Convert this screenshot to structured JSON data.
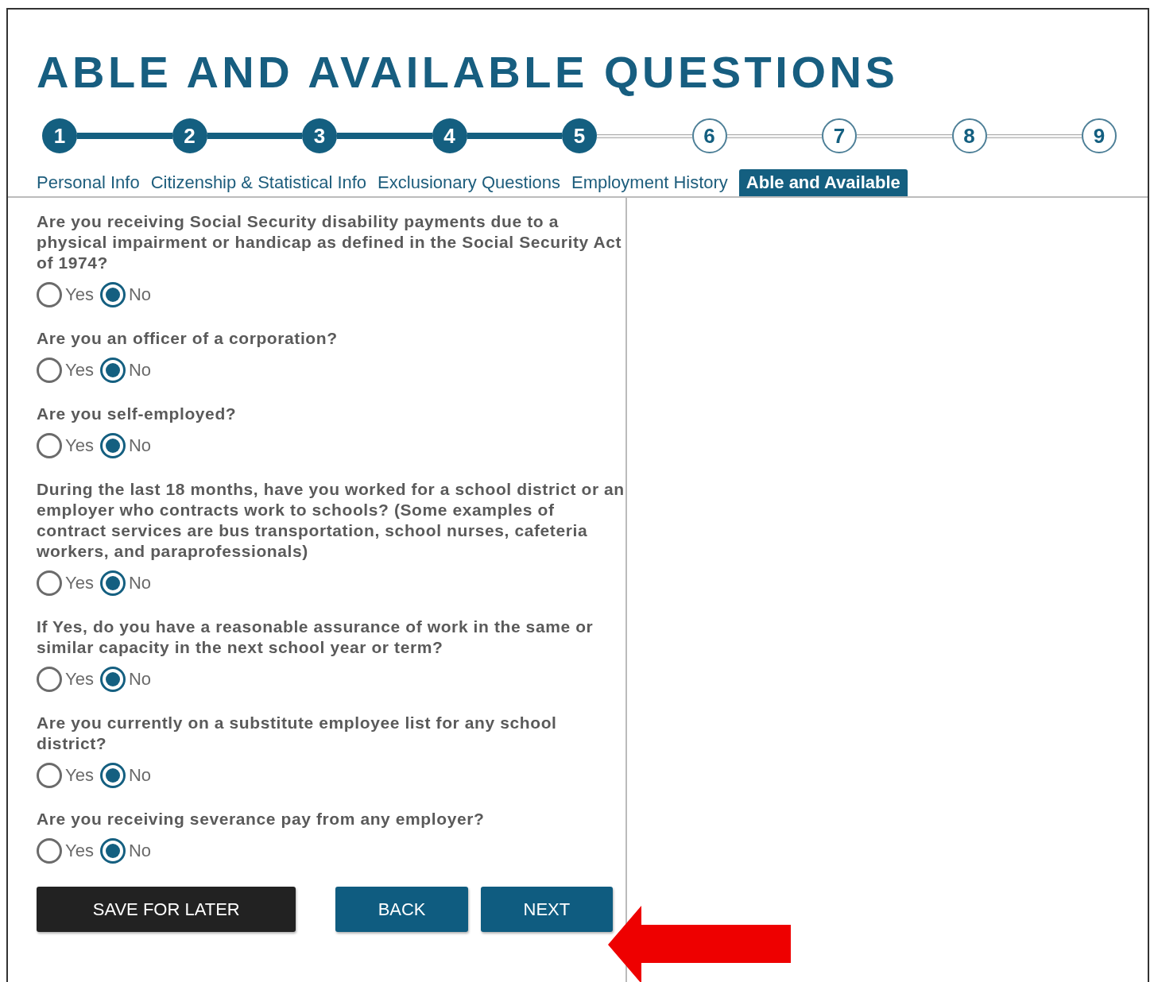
{
  "title": "ABLE AND AVAILABLE QUESTIONS",
  "steps": [
    {
      "number": "1",
      "done": true
    },
    {
      "number": "2",
      "done": true
    },
    {
      "number": "3",
      "done": true
    },
    {
      "number": "4",
      "done": true
    },
    {
      "number": "5",
      "done": true
    },
    {
      "number": "6",
      "done": false
    },
    {
      "number": "7",
      "done": false
    },
    {
      "number": "8",
      "done": false
    },
    {
      "number": "9",
      "done": false
    }
  ],
  "tabs": [
    {
      "label": "Personal Info",
      "selected": false
    },
    {
      "label": "Citizenship & Statistical Info",
      "selected": false
    },
    {
      "label": "Exclusionary Questions",
      "selected": false
    },
    {
      "label": "Employment History",
      "selected": false
    },
    {
      "label": "Able and Available",
      "selected": true
    }
  ],
  "questions": [
    {
      "text": "Are you receiving Social Security disability payments due to a physical impairment or handicap as defined in the Social Security Act of 1974?",
      "options": [
        {
          "label": "Yes",
          "selected": false
        },
        {
          "label": "No",
          "selected": true
        }
      ]
    },
    {
      "text": "Are you an officer of a corporation?",
      "options": [
        {
          "label": "Yes",
          "selected": false
        },
        {
          "label": "No",
          "selected": true
        }
      ]
    },
    {
      "text": "Are you self-employed?",
      "options": [
        {
          "label": "Yes",
          "selected": false
        },
        {
          "label": "No",
          "selected": true
        }
      ]
    },
    {
      "text": "During the last 18 months, have you worked for a school district or an employer who contracts work to schools? (Some examples of contract services are bus transportation, school nurses, cafeteria workers, and paraprofessionals)",
      "options": [
        {
          "label": "Yes",
          "selected": false
        },
        {
          "label": "No",
          "selected": true
        }
      ]
    },
    {
      "text": "If Yes, do you have a reasonable assurance of work in the same or similar capacity in the next school year or term?",
      "options": [
        {
          "label": "Yes",
          "selected": false
        },
        {
          "label": "No",
          "selected": true
        }
      ]
    },
    {
      "text": "Are you currently on a substitute employee list for any school district?",
      "options": [
        {
          "label": "Yes",
          "selected": false
        },
        {
          "label": "No",
          "selected": true
        }
      ]
    },
    {
      "text": "Are you receiving severance pay from any employer?",
      "options": [
        {
          "label": "Yes",
          "selected": false
        },
        {
          "label": "No",
          "selected": true
        }
      ]
    }
  ],
  "buttons": [
    {
      "label": "SAVE FOR LATER",
      "kind": "dark"
    },
    {
      "label": "BACK",
      "kind": "primary"
    },
    {
      "label": "NEXT",
      "kind": "primary"
    }
  ]
}
